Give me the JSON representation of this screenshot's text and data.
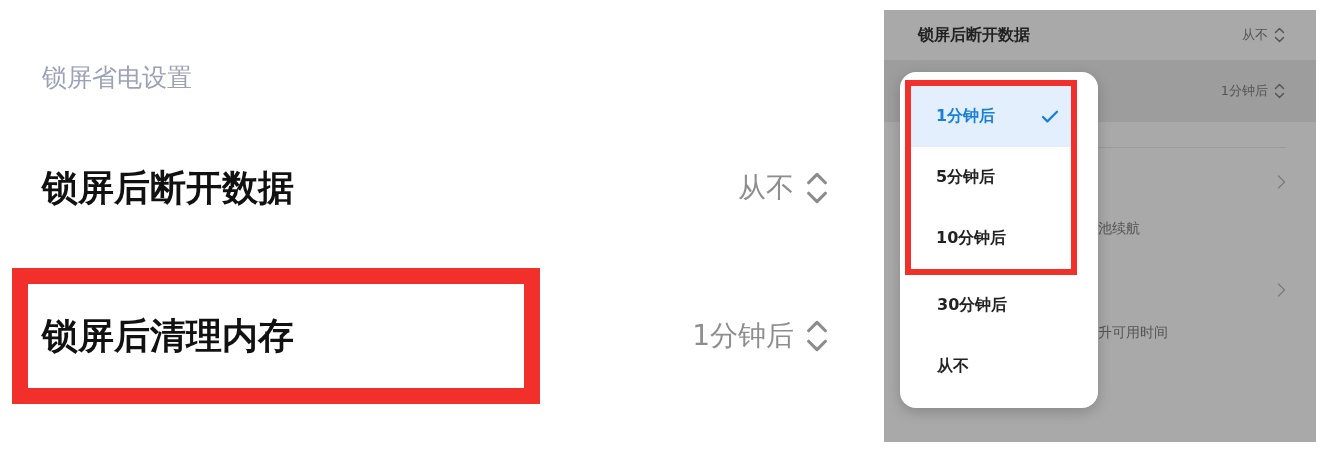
{
  "left_panel": {
    "section_title": "锁屏省电设置",
    "rows": [
      {
        "label": "锁屏后断开数据",
        "value": "从不",
        "highlighted": false
      },
      {
        "label": "锁屏后清理内存",
        "value": "1分钟后",
        "highlighted": true
      }
    ]
  },
  "right_panel": {
    "rows": [
      {
        "kind": "select",
        "label": "锁屏后断开数据",
        "value": "从不",
        "pressed": false
      },
      {
        "kind": "select",
        "value": "1分钟后",
        "pressed": true
      },
      {
        "kind": "divider"
      },
      {
        "kind": "link",
        "text": "池续航"
      },
      {
        "kind": "link",
        "text": "升可用时间"
      }
    ],
    "dropdown": {
      "options": [
        {
          "label": "1分钟后",
          "selected": true,
          "highlighted": true
        },
        {
          "label": "5分钟后",
          "selected": false,
          "highlighted": true
        },
        {
          "label": "10分钟后",
          "selected": false,
          "highlighted": true
        },
        {
          "label": "30分钟后",
          "selected": false,
          "highlighted": false
        },
        {
          "label": "从不",
          "selected": false,
          "highlighted": false
        }
      ]
    }
  }
}
